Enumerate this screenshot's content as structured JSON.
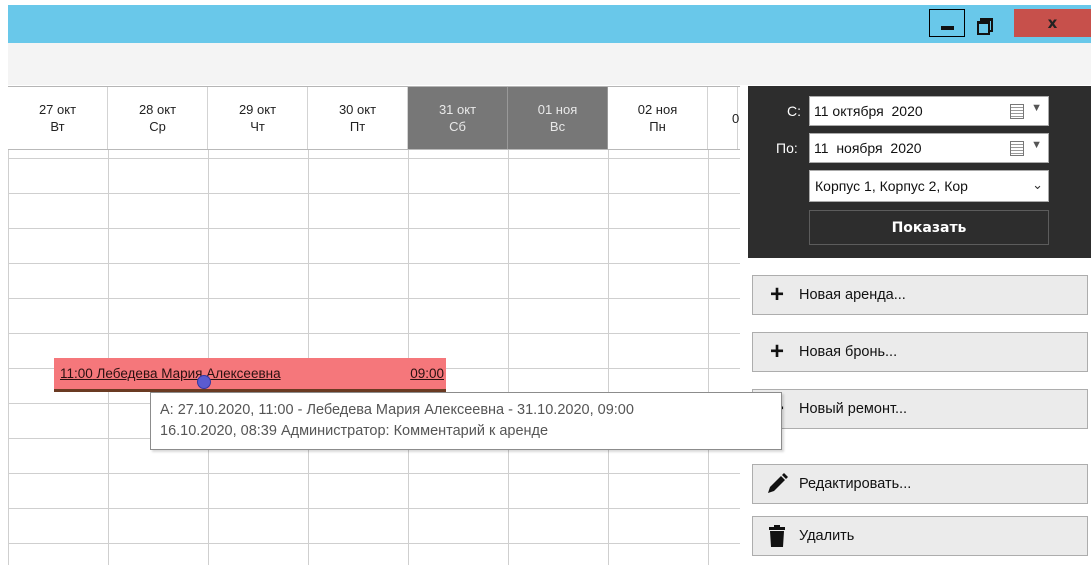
{
  "window": {
    "close_label": "x"
  },
  "calendar": {
    "days": [
      {
        "date": "27 окт",
        "weekday": "Вт",
        "weekend": false
      },
      {
        "date": "28 окт",
        "weekday": "Ср",
        "weekend": false
      },
      {
        "date": "29 окт",
        "weekday": "Чт",
        "weekend": false
      },
      {
        "date": "30 окт",
        "weekday": "Пт",
        "weekend": false
      },
      {
        "date": "31 окт",
        "weekday": "Сб",
        "weekend": true
      },
      {
        "date": "01 ноя",
        "weekday": "Вс",
        "weekend": true
      },
      {
        "date": "02 ноя",
        "weekday": "Пн",
        "weekend": false
      },
      {
        "date": "0",
        "weekday": "",
        "weekend": false
      }
    ],
    "booking": {
      "start_time": "11:00",
      "guest": "Лебедева Мария Алексеевна",
      "end_time": "09:00",
      "color": "#f5777b"
    },
    "tooltip": {
      "line1": "А: 27.10.2020, 11:00 - Лебедева Мария Алексеевна - 31.10.2020, 09:00",
      "line2": "16.10.2020, 08:39 Администратор: Комментарий к аренде"
    }
  },
  "filter": {
    "from_label": "С:",
    "from_value": "11 октября  2020",
    "to_label": "По:",
    "to_value": "11  ноября  2020",
    "buildings_value": "Корпус 1, Корпус 2, Кор",
    "show_label": "Показать"
  },
  "actions": [
    {
      "label": "Новая аренда...",
      "icon": "plus-icon"
    },
    {
      "label": "Новая бронь...",
      "icon": "plus-icon"
    },
    {
      "label": "Новый ремонт...",
      "icon": "plus-icon"
    },
    {
      "label": "Редактировать...",
      "icon": "pencil-icon"
    },
    {
      "label": "Удалить",
      "icon": "trash-icon"
    }
  ],
  "colors": {
    "titlebar": "#69c8ea",
    "close_button": "#c7504b",
    "weekend_header": "#777777",
    "side_panel": "#2d2d2d"
  }
}
